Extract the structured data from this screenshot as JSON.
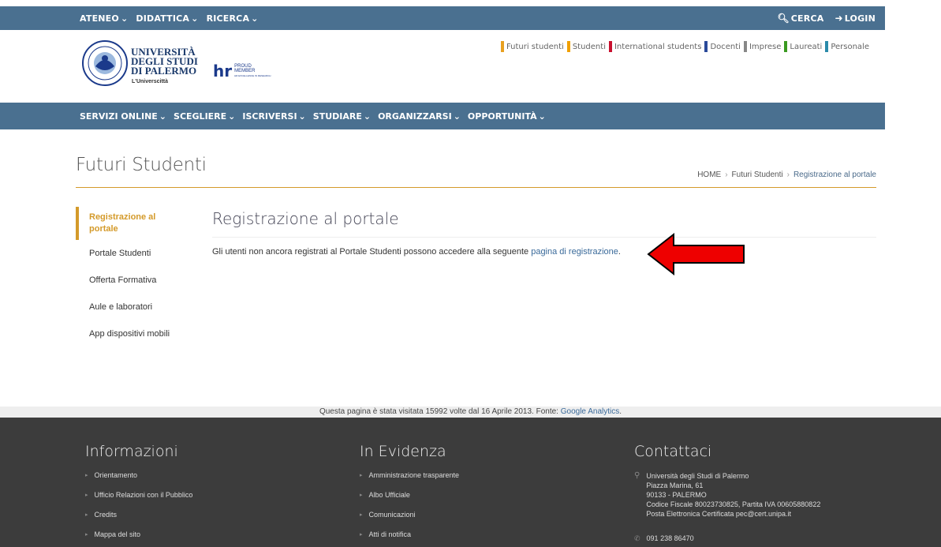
{
  "topbar": {
    "nav": [
      "ATENEO",
      "DIDATTICA",
      "RICERCA"
    ],
    "search_label": "CERCA",
    "login_label": "LOGIN"
  },
  "header": {
    "logo_line1": "UNIVERSITÀ",
    "logo_line2": "DEGLI STUDI",
    "logo_line3": "DI PALERMO",
    "logo_sub": "L'Universcittà",
    "hr_text": "hr",
    "hr_proud": "PROUD",
    "hr_member": "MEMBER",
    "hr_tagline": "HR EXCELLENCE IN RESEARCH",
    "audience": [
      {
        "label": "Futuri studenti",
        "color": "#e8a020"
      },
      {
        "label": "Studenti",
        "color": "#f0a000"
      },
      {
        "label": "International students",
        "color": "#c8102e"
      },
      {
        "label": "Docenti",
        "color": "#2a4a9a"
      },
      {
        "label": "Imprese",
        "color": "#888888"
      },
      {
        "label": "Laureati",
        "color": "#3a9a20"
      },
      {
        "label": "Personale",
        "color": "#2a8aaa"
      }
    ]
  },
  "mainnav": [
    "SERVIZI ONLINE",
    "SCEGLIERE",
    "ISCRIVERSI",
    "STUDIARE",
    "ORGANIZZARSI",
    "OPPORTUNITÀ"
  ],
  "page": {
    "title": "Futuri Studenti",
    "breadcrumb": [
      "HOME",
      "Futuri Studenti",
      "Registrazione al portale"
    ]
  },
  "sidebar": {
    "items": [
      "Registrazione al portale",
      "Portale Studenti",
      "Offerta Formativa",
      "Aule e laboratori",
      "App dispositivi mobili"
    ]
  },
  "content": {
    "title": "Registrazione al portale",
    "text": "Gli utenti non ancora registrati al Portale Studenti possono accedere alla seguente ",
    "link": "pagina di registrazione",
    "period": "."
  },
  "visits": {
    "text": "Questa pagina è stata visitata 15992 volte dal 16 Aprile 2013. Fonte:  ",
    "source": "Google Analytics",
    "period": "."
  },
  "footer": {
    "info": {
      "title": "Informazioni",
      "items": [
        "Orientamento",
        "Ufficio Relazioni con il Pubblico",
        "Credits",
        "Mappa del sito"
      ]
    },
    "evidence": {
      "title": "In Evidenza",
      "items": [
        "Amministrazione trasparente",
        "Albo Ufficiale",
        "Comunicazioni",
        "Atti di notifica"
      ]
    },
    "contact": {
      "title": "Contattaci",
      "lines": [
        "Università degli Studi di Palermo",
        "Piazza Marina, 61",
        "90133 - PALERMO",
        "Codice Fiscale 80023730825, Partita IVA 00605880822",
        "Posta Elettronica Certificata pec@cert.unipa.it"
      ],
      "phone": "091 238 86470"
    }
  },
  "colors": {
    "nav_blue": "#4a7090",
    "accent_gold": "#d49a2a",
    "footer_dark": "#3c3c3c",
    "arrow_red": "#ee0000"
  }
}
